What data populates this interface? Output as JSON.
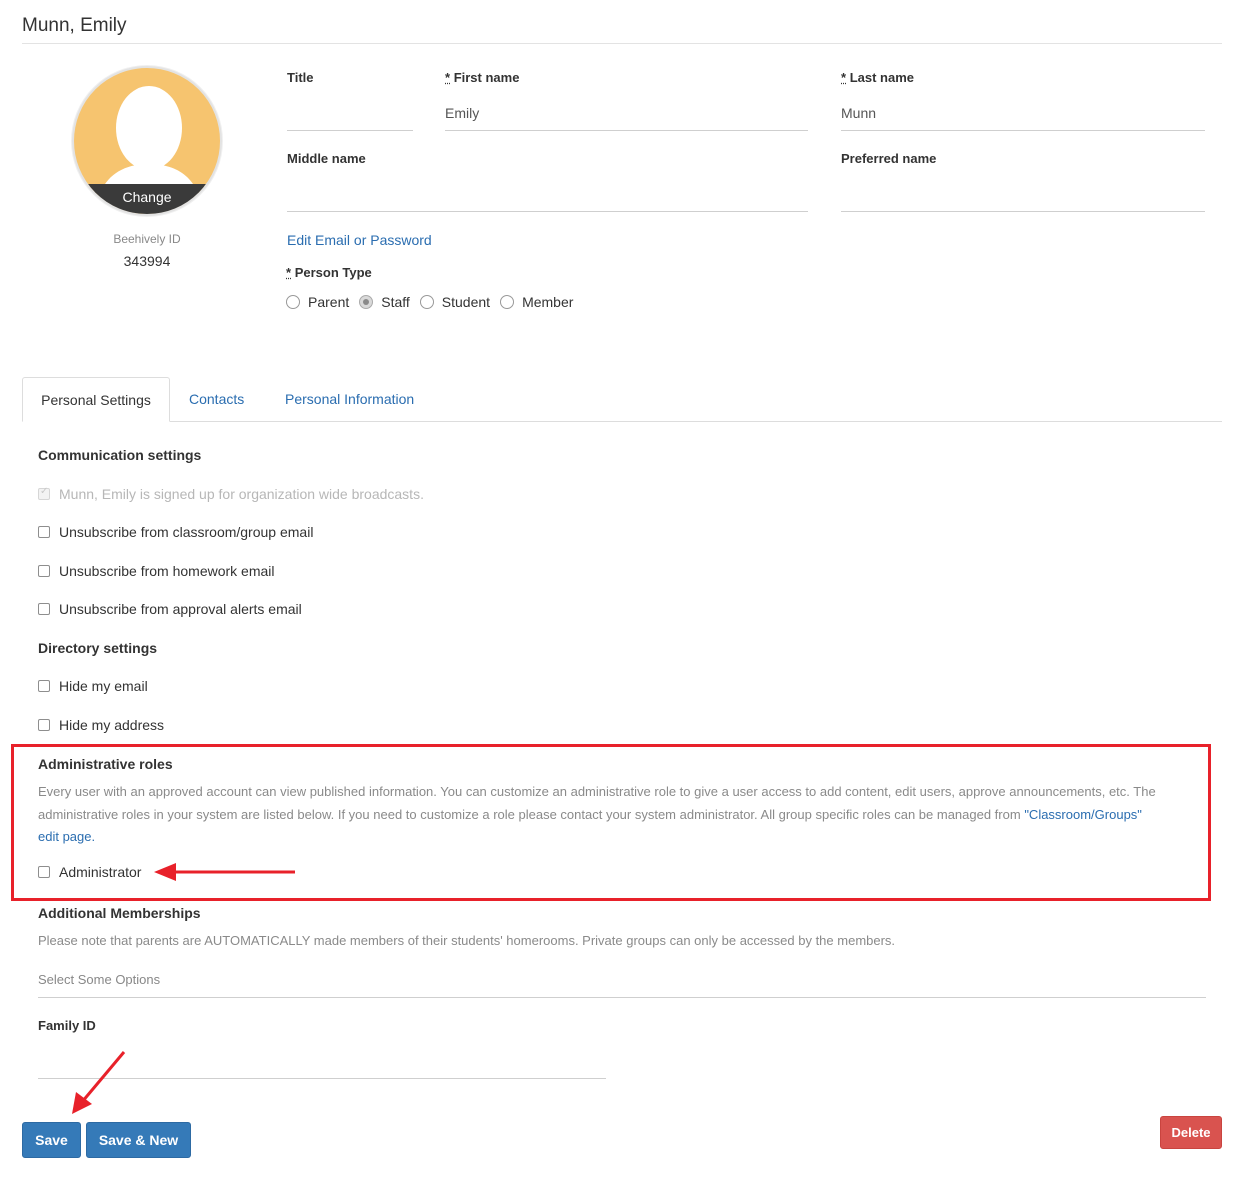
{
  "header": {
    "title": "Munn, Emily"
  },
  "avatar": {
    "change_label": "Change",
    "id_label": "Beehively ID",
    "id_value": "343994"
  },
  "fields": {
    "title": {
      "label": "Title",
      "value": ""
    },
    "first_name": {
      "req_mark": "*",
      "label": "First name",
      "value": "Emily"
    },
    "last_name": {
      "req_mark": "*",
      "label": "Last name",
      "value": "Munn"
    },
    "middle_name": {
      "label": "Middle name",
      "value": ""
    },
    "preferred_name": {
      "label": "Preferred name",
      "value": ""
    }
  },
  "edit_link": "Edit Email or Password",
  "person_type": {
    "req_mark": "*",
    "label": "Person Type",
    "options": [
      "Parent",
      "Staff",
      "Student",
      "Member"
    ],
    "selected": "Staff"
  },
  "tabs": [
    {
      "label": "Personal Settings",
      "active": true
    },
    {
      "label": "Contacts",
      "active": false
    },
    {
      "label": "Personal Information",
      "active": false
    }
  ],
  "communication": {
    "heading": "Communication settings",
    "broadcast_text": "Munn, Emily is signed up for organization wide broadcasts.",
    "items": [
      "Unsubscribe from classroom/group email",
      "Unsubscribe from homework email",
      "Unsubscribe from approval alerts email"
    ]
  },
  "directory": {
    "heading": "Directory settings",
    "items": [
      "Hide my email",
      "Hide my address"
    ]
  },
  "admin_roles": {
    "heading": "Administrative roles",
    "help_line1": "Every user with an approved account can view published information. You can customize an administrative role to give a user access to add content, edit users, approve announcements, etc. The",
    "help_line2": "administrative roles in your system are listed below. If you need to customize a role please contact your system administrator. All group specific roles can be managed from",
    "help_link_a": "\"Classroom/Groups\"",
    "help_link_b": "edit page.",
    "role": "Administrator"
  },
  "memberships": {
    "heading": "Additional Memberships",
    "note": "Please note that parents are AUTOMATICALLY made members of their students' homerooms. Private groups can only be accessed by the members.",
    "placeholder": "Select Some Options"
  },
  "family_id": {
    "label": "Family ID",
    "value": ""
  },
  "buttons": {
    "save": "Save",
    "save_new": "Save & New",
    "delete": "Delete"
  },
  "colors": {
    "annotation": "#e8212a",
    "primary": "#357ab8",
    "danger": "#d9534f",
    "link": "#2a6db0"
  }
}
